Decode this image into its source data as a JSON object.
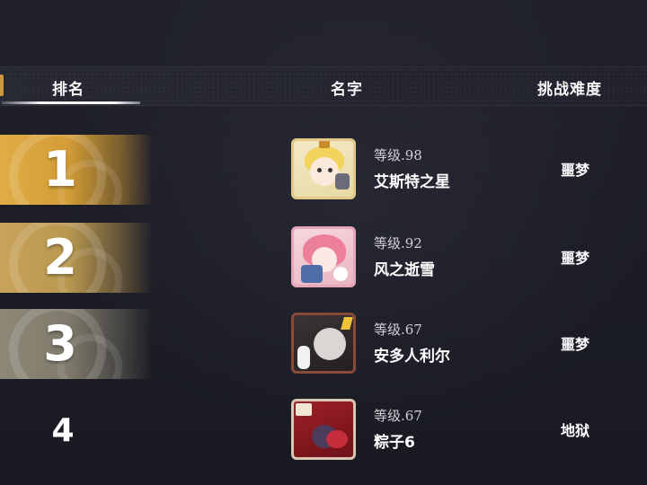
{
  "header": {
    "rank_label": "排名",
    "name_label": "名字",
    "difficulty_label": "挑战难度"
  },
  "rows": [
    {
      "rank": "1",
      "level": "等级.98",
      "name": "艾斯特之星",
      "difficulty": "噩梦",
      "avatar": "chibi-blonde-avatar"
    },
    {
      "rank": "2",
      "level": "等级.92",
      "name": "风之逝雪",
      "difficulty": "噩梦",
      "avatar": "pink-hair-avatar"
    },
    {
      "rank": "3",
      "level": "等级.67",
      "name": "安多人利尔",
      "difficulty": "噩梦",
      "avatar": "white-hair-avatar"
    },
    {
      "rank": "4",
      "level": "等级.67",
      "name": "粽子6",
      "difficulty": "地狱",
      "avatar": "anniversary-card-avatar"
    }
  ],
  "colors": {
    "gold": "#d9a741",
    "silver_gold": "#b99a56",
    "bronze": "#8f8a78",
    "background": "#1b1c24"
  }
}
